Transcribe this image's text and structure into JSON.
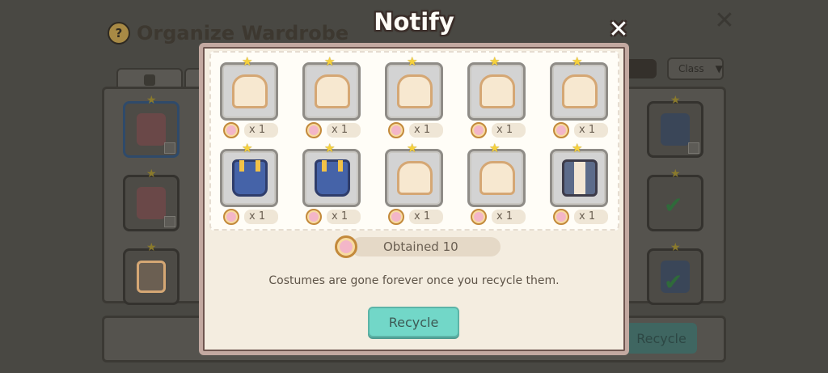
{
  "background": {
    "title": "Organize Wardrobe",
    "help_icon": "question-mark-icon",
    "close_icon": "x-icon",
    "class_dropdown": "Class",
    "recycle_label": "Recycle"
  },
  "modal": {
    "title": "Notify",
    "close_icon": "x-icon",
    "items": [
      {
        "type": "bread-costume",
        "quantity": "x 1"
      },
      {
        "type": "bread-costume",
        "quantity": "x 1"
      },
      {
        "type": "bread-costume",
        "quantity": "x 1"
      },
      {
        "type": "bread-costume",
        "quantity": "x 1"
      },
      {
        "type": "bread-costume",
        "quantity": "x 1"
      },
      {
        "type": "blue-overalls-costume",
        "quantity": "x 1"
      },
      {
        "type": "blue-overalls-costume",
        "quantity": "x 1"
      },
      {
        "type": "bread-costume",
        "quantity": "x 1"
      },
      {
        "type": "bread-costume",
        "quantity": "x 1"
      },
      {
        "type": "vest-costume",
        "quantity": "x 1"
      }
    ],
    "obtained_label": "Obtained 10",
    "notice": "Costumes are gone forever once you recycle them.",
    "recycle_button": "Recycle"
  },
  "colors": {
    "modal_bg": "#f4ede0",
    "recycle_button": "#72d7c8",
    "star": "#f6d13b"
  }
}
